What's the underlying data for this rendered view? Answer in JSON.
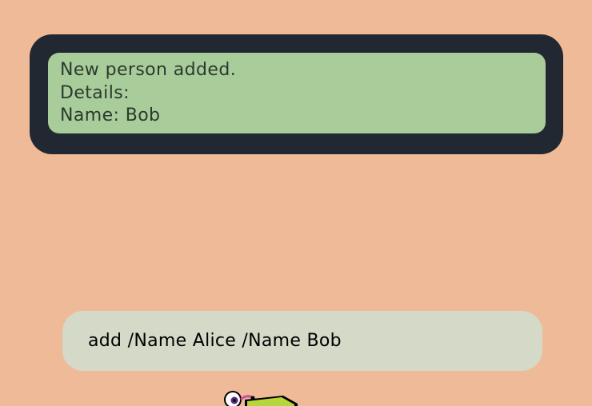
{
  "result": {
    "lines": [
      "New person added.",
      "Details:",
      "Name: Bob"
    ]
  },
  "command": {
    "value": "add /Name Alice /Name Bob"
  },
  "colors": {
    "background": "#EEBA98",
    "result_panel": "#222831",
    "result_box": "#A8CC9A",
    "command_box": "#D5D9C8"
  },
  "mascot": {
    "icon": "mascot-icon"
  }
}
